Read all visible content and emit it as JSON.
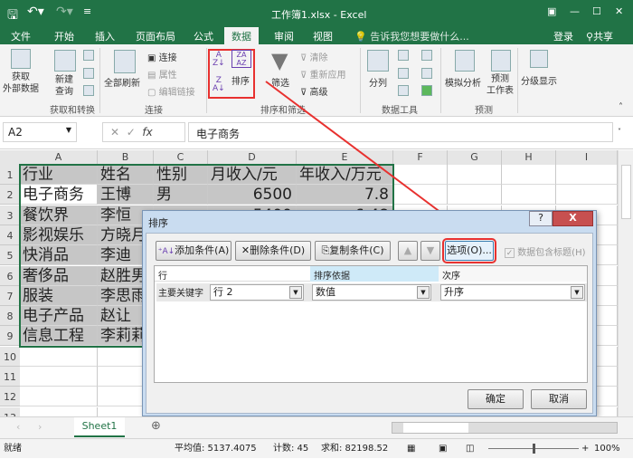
{
  "window": {
    "title": "工作簿1.xlsx - Excel"
  },
  "tabs": [
    "文件",
    "开始",
    "插入",
    "页面布局",
    "公式",
    "数据",
    "审阅",
    "视图"
  ],
  "active_tab": "数据",
  "tell_me": "告诉我您想要做什么...",
  "sign_in": "登录",
  "share": "共享",
  "ribbon": {
    "get_external": "获取\n外部数据",
    "new_query": "新建\n查询",
    "group1": "获取和转换",
    "refresh_all": "全部刷新",
    "connections": "连接",
    "properties": "属性",
    "edit_links": "编辑链接",
    "group2": "连接",
    "sort": "排序",
    "filter": "筛选",
    "clear": "清除",
    "reapply": "重新应用",
    "advanced": "高级",
    "group3": "排序和筛选",
    "text_to_columns": "分列",
    "group4": "数据工具",
    "what_if": "模拟分析",
    "forecast_sheet": "预测\n工作表",
    "group5": "预测",
    "outline": "分级显示"
  },
  "formula_bar": {
    "name_box": "A2",
    "fx": "fx",
    "value": "电子商务"
  },
  "columns": [
    "A",
    "B",
    "C",
    "D",
    "E",
    "F",
    "G",
    "H",
    "I"
  ],
  "rows": [
    "1",
    "2",
    "3",
    "4",
    "5",
    "6",
    "7",
    "8",
    "9",
    "10",
    "11",
    "12",
    "13"
  ],
  "cells": [
    [
      "行业",
      "姓名",
      "性别",
      "月收入/元",
      "年收入/万元"
    ],
    [
      "电子商务",
      "王博",
      "男",
      "6500",
      "7.8"
    ],
    [
      "餐饮界",
      "李恒",
      "",
      "5400",
      "6.48"
    ],
    [
      "影视娱乐",
      "方晓月"
    ],
    [
      "快消品",
      "李迪"
    ],
    [
      "奢侈品",
      "赵胜男"
    ],
    [
      "服装",
      "李思雨"
    ],
    [
      "电子产品",
      "赵让"
    ],
    [
      "信息工程",
      "李莉莉"
    ]
  ],
  "dialog": {
    "title": "排序",
    "help": "?",
    "close": "X",
    "add": "添加条件(A)",
    "delete": "删除条件(D)",
    "copy": "复制条件(C)",
    "options": "选项(O)...",
    "has_headers": "数据包含标题(H)",
    "has_headers_checked": true,
    "headers": [
      "行",
      "排序依据",
      "次序"
    ],
    "row_label": "主要关键字",
    "key": "行 2",
    "sort_on": "数值",
    "order": "升序",
    "ok": "确定",
    "cancel": "取消"
  },
  "sheet_tab": "Sheet1",
  "status": {
    "ready": "就绪",
    "average": "平均值: 5137.4075",
    "count": "计数: 45",
    "sum": "求和: 82198.52",
    "zoom": "100%"
  },
  "colors": {
    "excel_green": "#217346",
    "highlight_red": "#e8312f"
  }
}
